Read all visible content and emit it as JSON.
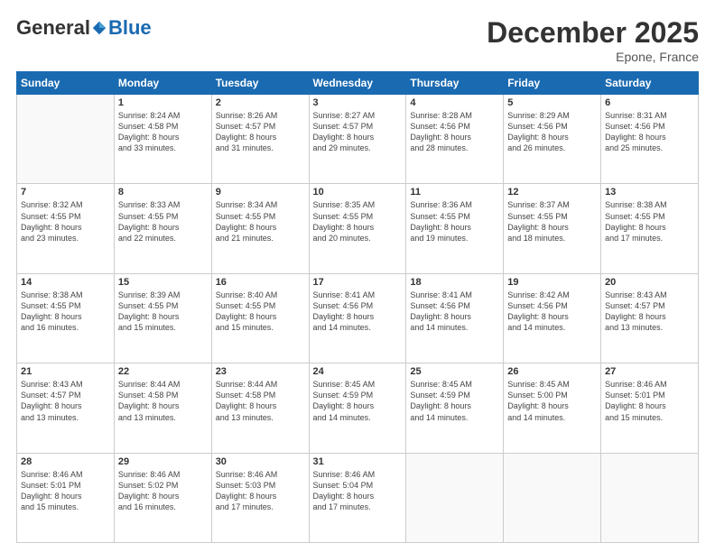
{
  "header": {
    "logo_general": "General",
    "logo_blue": "Blue",
    "month_title": "December 2025",
    "location": "Epone, France"
  },
  "days_of_week": [
    "Sunday",
    "Monday",
    "Tuesday",
    "Wednesday",
    "Thursday",
    "Friday",
    "Saturday"
  ],
  "weeks": [
    [
      {
        "day": "",
        "info": ""
      },
      {
        "day": "1",
        "info": "Sunrise: 8:24 AM\nSunset: 4:58 PM\nDaylight: 8 hours\nand 33 minutes."
      },
      {
        "day": "2",
        "info": "Sunrise: 8:26 AM\nSunset: 4:57 PM\nDaylight: 8 hours\nand 31 minutes."
      },
      {
        "day": "3",
        "info": "Sunrise: 8:27 AM\nSunset: 4:57 PM\nDaylight: 8 hours\nand 29 minutes."
      },
      {
        "day": "4",
        "info": "Sunrise: 8:28 AM\nSunset: 4:56 PM\nDaylight: 8 hours\nand 28 minutes."
      },
      {
        "day": "5",
        "info": "Sunrise: 8:29 AM\nSunset: 4:56 PM\nDaylight: 8 hours\nand 26 minutes."
      },
      {
        "day": "6",
        "info": "Sunrise: 8:31 AM\nSunset: 4:56 PM\nDaylight: 8 hours\nand 25 minutes."
      }
    ],
    [
      {
        "day": "7",
        "info": "Sunrise: 8:32 AM\nSunset: 4:55 PM\nDaylight: 8 hours\nand 23 minutes."
      },
      {
        "day": "8",
        "info": "Sunrise: 8:33 AM\nSunset: 4:55 PM\nDaylight: 8 hours\nand 22 minutes."
      },
      {
        "day": "9",
        "info": "Sunrise: 8:34 AM\nSunset: 4:55 PM\nDaylight: 8 hours\nand 21 minutes."
      },
      {
        "day": "10",
        "info": "Sunrise: 8:35 AM\nSunset: 4:55 PM\nDaylight: 8 hours\nand 20 minutes."
      },
      {
        "day": "11",
        "info": "Sunrise: 8:36 AM\nSunset: 4:55 PM\nDaylight: 8 hours\nand 19 minutes."
      },
      {
        "day": "12",
        "info": "Sunrise: 8:37 AM\nSunset: 4:55 PM\nDaylight: 8 hours\nand 18 minutes."
      },
      {
        "day": "13",
        "info": "Sunrise: 8:38 AM\nSunset: 4:55 PM\nDaylight: 8 hours\nand 17 minutes."
      }
    ],
    [
      {
        "day": "14",
        "info": "Sunrise: 8:38 AM\nSunset: 4:55 PM\nDaylight: 8 hours\nand 16 minutes."
      },
      {
        "day": "15",
        "info": "Sunrise: 8:39 AM\nSunset: 4:55 PM\nDaylight: 8 hours\nand 15 minutes."
      },
      {
        "day": "16",
        "info": "Sunrise: 8:40 AM\nSunset: 4:55 PM\nDaylight: 8 hours\nand 15 minutes."
      },
      {
        "day": "17",
        "info": "Sunrise: 8:41 AM\nSunset: 4:56 PM\nDaylight: 8 hours\nand 14 minutes."
      },
      {
        "day": "18",
        "info": "Sunrise: 8:41 AM\nSunset: 4:56 PM\nDaylight: 8 hours\nand 14 minutes."
      },
      {
        "day": "19",
        "info": "Sunrise: 8:42 AM\nSunset: 4:56 PM\nDaylight: 8 hours\nand 14 minutes."
      },
      {
        "day": "20",
        "info": "Sunrise: 8:43 AM\nSunset: 4:57 PM\nDaylight: 8 hours\nand 13 minutes."
      }
    ],
    [
      {
        "day": "21",
        "info": "Sunrise: 8:43 AM\nSunset: 4:57 PM\nDaylight: 8 hours\nand 13 minutes."
      },
      {
        "day": "22",
        "info": "Sunrise: 8:44 AM\nSunset: 4:58 PM\nDaylight: 8 hours\nand 13 minutes."
      },
      {
        "day": "23",
        "info": "Sunrise: 8:44 AM\nSunset: 4:58 PM\nDaylight: 8 hours\nand 13 minutes."
      },
      {
        "day": "24",
        "info": "Sunrise: 8:45 AM\nSunset: 4:59 PM\nDaylight: 8 hours\nand 14 minutes."
      },
      {
        "day": "25",
        "info": "Sunrise: 8:45 AM\nSunset: 4:59 PM\nDaylight: 8 hours\nand 14 minutes."
      },
      {
        "day": "26",
        "info": "Sunrise: 8:45 AM\nSunset: 5:00 PM\nDaylight: 8 hours\nand 14 minutes."
      },
      {
        "day": "27",
        "info": "Sunrise: 8:46 AM\nSunset: 5:01 PM\nDaylight: 8 hours\nand 15 minutes."
      }
    ],
    [
      {
        "day": "28",
        "info": "Sunrise: 8:46 AM\nSunset: 5:01 PM\nDaylight: 8 hours\nand 15 minutes."
      },
      {
        "day": "29",
        "info": "Sunrise: 8:46 AM\nSunset: 5:02 PM\nDaylight: 8 hours\nand 16 minutes."
      },
      {
        "day": "30",
        "info": "Sunrise: 8:46 AM\nSunset: 5:03 PM\nDaylight: 8 hours\nand 17 minutes."
      },
      {
        "day": "31",
        "info": "Sunrise: 8:46 AM\nSunset: 5:04 PM\nDaylight: 8 hours\nand 17 minutes."
      },
      {
        "day": "",
        "info": ""
      },
      {
        "day": "",
        "info": ""
      },
      {
        "day": "",
        "info": ""
      }
    ]
  ]
}
